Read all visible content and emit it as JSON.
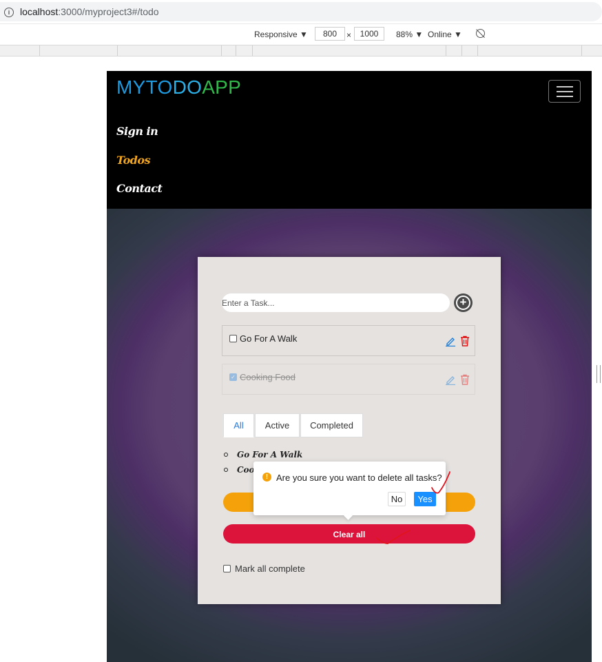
{
  "browser": {
    "url_host": "localhost",
    "url_path": ":3000/myproject3#/todo"
  },
  "devtools": {
    "mode": "Responsive ▼",
    "width": "800",
    "times": "×",
    "height": "1000",
    "zoom": "88% ▼",
    "network": "Online ▼"
  },
  "navbar": {
    "brand_1": "MYTO",
    "brand_2": "DO",
    "brand_3": "APP",
    "links": [
      "Sign in",
      "Todos",
      "Contact"
    ]
  },
  "todo": {
    "input_placeholder": "Enter a Task...",
    "add_symbol": "+",
    "items": [
      {
        "text": "Go For A Walk",
        "completed": false
      },
      {
        "text": "Cooking Food",
        "completed": true
      }
    ],
    "tabs": [
      "All",
      "Active",
      "Completed"
    ],
    "list": [
      "Go For A Walk",
      "Cook"
    ],
    "clear_all_label": "Clear all",
    "mark_all_label": "Mark all complete"
  },
  "confirm": {
    "message": "Are you sure you want to delete all tasks?",
    "no_label": "No",
    "yes_label": "Yes"
  },
  "colors": {
    "brand_blue": "#1e9be0",
    "brand_green": "#31b84a",
    "active_nav": "#f0a520",
    "clear_all": "#dc143c",
    "orange_button": "#f5a20a",
    "primary": "#1890ff",
    "annotation": "#e0141e"
  }
}
